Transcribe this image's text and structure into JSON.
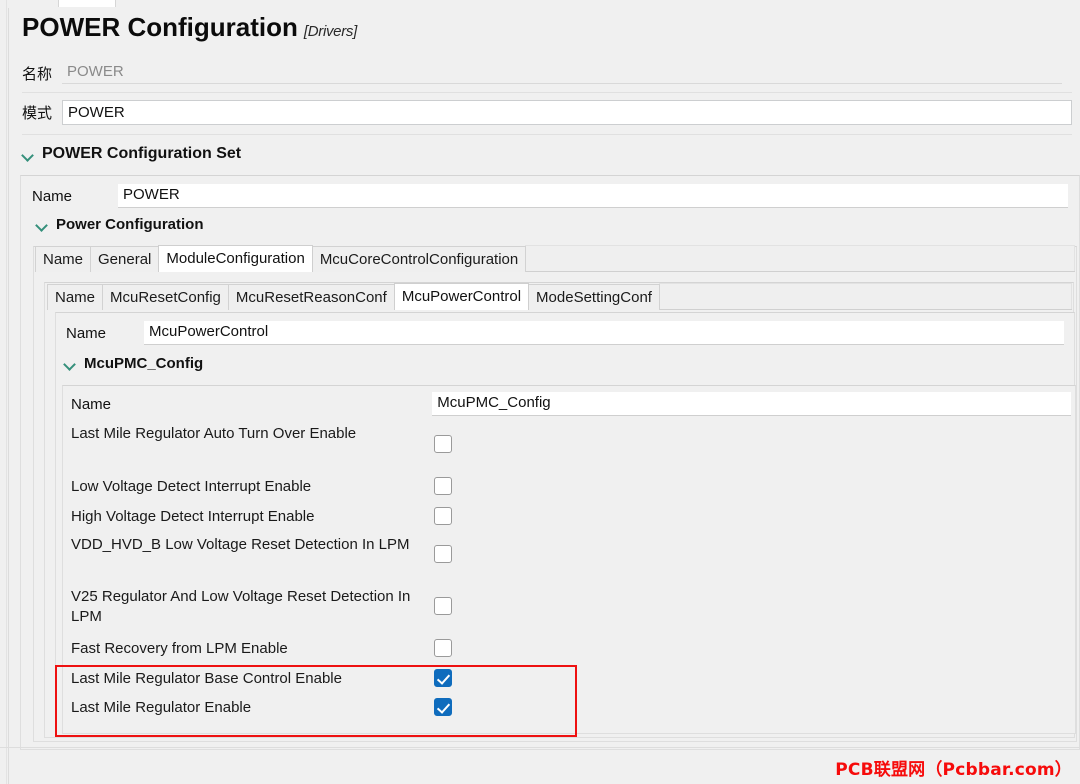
{
  "header": {
    "title": "POWER Configuration",
    "subtitle": "[Drivers]",
    "name_label": "名称",
    "name_value": "POWER",
    "mode_label": "模式",
    "mode_value": "POWER"
  },
  "sections": {
    "config_set": {
      "title": "POWER Configuration Set",
      "name_label": "Name",
      "name_value": "POWER"
    },
    "power_configuration": {
      "title": "Power Configuration"
    },
    "mcupmc_config": {
      "title": "McuPMC_Config",
      "name_label": "Name",
      "name_value": "McuPMC_Config"
    }
  },
  "tabs_level1": [
    {
      "label": "Name",
      "active": false
    },
    {
      "label": "General",
      "active": false
    },
    {
      "label": "ModuleConfiguration",
      "active": true
    },
    {
      "label": "McuCoreControlConfiguration",
      "active": false
    }
  ],
  "tabs_level2": [
    {
      "label": "Name",
      "active": false
    },
    {
      "label": "McuResetConfig",
      "active": false
    },
    {
      "label": "McuResetReasonConf",
      "active": false
    },
    {
      "label": "McuPowerControl",
      "active": true
    },
    {
      "label": "ModeSettingConf",
      "active": false
    }
  ],
  "mcupowercontrol": {
    "name_label": "Name",
    "name_value": "McuPowerControl"
  },
  "checkbox_rows": [
    {
      "label": "Last Mile Regulator Auto Turn Over Enable",
      "checked": false,
      "lines": 2
    },
    {
      "label": "Low Voltage Detect Interrupt Enable",
      "checked": false,
      "lines": 1
    },
    {
      "label": "High Voltage Detect Interrupt Enable",
      "checked": false,
      "lines": 1
    },
    {
      "label": "VDD_HVD_B Low Voltage Reset Detection In LPM",
      "checked": false,
      "lines": 2
    },
    {
      "label": "V25 Regulator And Low Voltage Reset Detection In LPM",
      "checked": false,
      "lines": 2
    },
    {
      "label": "Fast Recovery from LPM Enable",
      "checked": false,
      "lines": 1
    },
    {
      "label": "Last Mile Regulator Base Control Enable",
      "checked": true,
      "lines": 1
    },
    {
      "label": "Last Mile Regulator Enable",
      "checked": true,
      "lines": 1
    }
  ],
  "annotation": {
    "highlight_color": "#ee1111",
    "highlight_rows": [
      "Last Mile Regulator Base Control Enable",
      "Last Mile Regulator Enable"
    ]
  },
  "watermark": {
    "text": "PCB联盟网（Pcbbar.com）",
    "color": "#f60b0b"
  },
  "colors": {
    "background": "#f0f0f0",
    "chevron": "#35907b",
    "checkbox_checked": "#0f6cbd",
    "panel_border": "#dedede"
  }
}
